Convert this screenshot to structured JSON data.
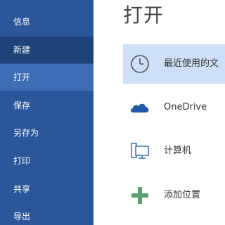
{
  "sidebar": {
    "items": [
      {
        "label": "信息"
      },
      {
        "label": "新建"
      },
      {
        "label": "打开"
      },
      {
        "label": "保存"
      },
      {
        "label": "另存为"
      },
      {
        "label": "打印"
      },
      {
        "label": "共享"
      },
      {
        "label": "导出"
      }
    ],
    "active_index": 2,
    "hover_index": 1
  },
  "main": {
    "title": "打开",
    "locations": [
      {
        "label": "最近使用的文",
        "icon": "clock-icon"
      },
      {
        "label": "OneDrive",
        "icon": "onedrive-cloud-icon"
      },
      {
        "label": "计算机",
        "icon": "computer-icon"
      },
      {
        "label": "添加位置",
        "icon": "plus-icon"
      }
    ]
  },
  "colors": {
    "sidebar_bg": "#2b579a",
    "sidebar_active": "#3e6db5",
    "sidebar_hover": "#1e4379",
    "selected_location_bg": "#cde0f7",
    "onedrive_blue": "#1e5aa8",
    "plus_green": "#5a9f6f"
  }
}
